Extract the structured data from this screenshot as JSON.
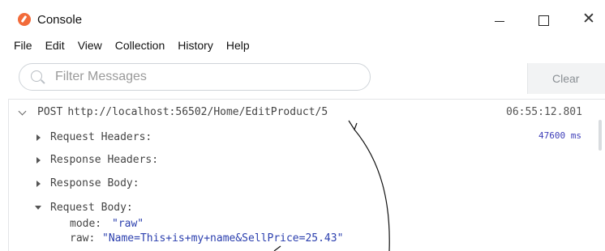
{
  "window": {
    "title": "Console",
    "close_glyph": "✕"
  },
  "menu": [
    "File",
    "Edit",
    "View",
    "Collection",
    "History",
    "Help"
  ],
  "filter": {
    "placeholder": "Filter Messages",
    "value": ""
  },
  "toolbar": {
    "clear_label": "Clear"
  },
  "request": {
    "method": "POST",
    "url": "http://localhost:56502/Home/EditProduct/5",
    "timestamp": "06:55:12.801",
    "duration": "47600 ms",
    "sections": [
      {
        "label": "Request Headers:",
        "expanded": false
      },
      {
        "label": "Response Headers:",
        "expanded": false
      },
      {
        "label": "Response Body:",
        "expanded": false
      },
      {
        "label": "Request Body:",
        "expanded": true
      }
    ],
    "body": {
      "mode_key": "mode:",
      "mode_value": "\"raw\"",
      "raw_key": "raw:",
      "raw_value": "\"Name=This+is+my+name&SellPrice=25.43\""
    }
  },
  "colors": {
    "app_icon": "#f26b3a",
    "value_blue": "#2b3fae",
    "duration_blue": "#3d3db8"
  },
  "icons": [
    "app-icon",
    "minimize-icon",
    "maximize-icon",
    "close-icon",
    "search-icon",
    "chevron-down-icon",
    "triangle-right-icon",
    "triangle-down-icon"
  ]
}
